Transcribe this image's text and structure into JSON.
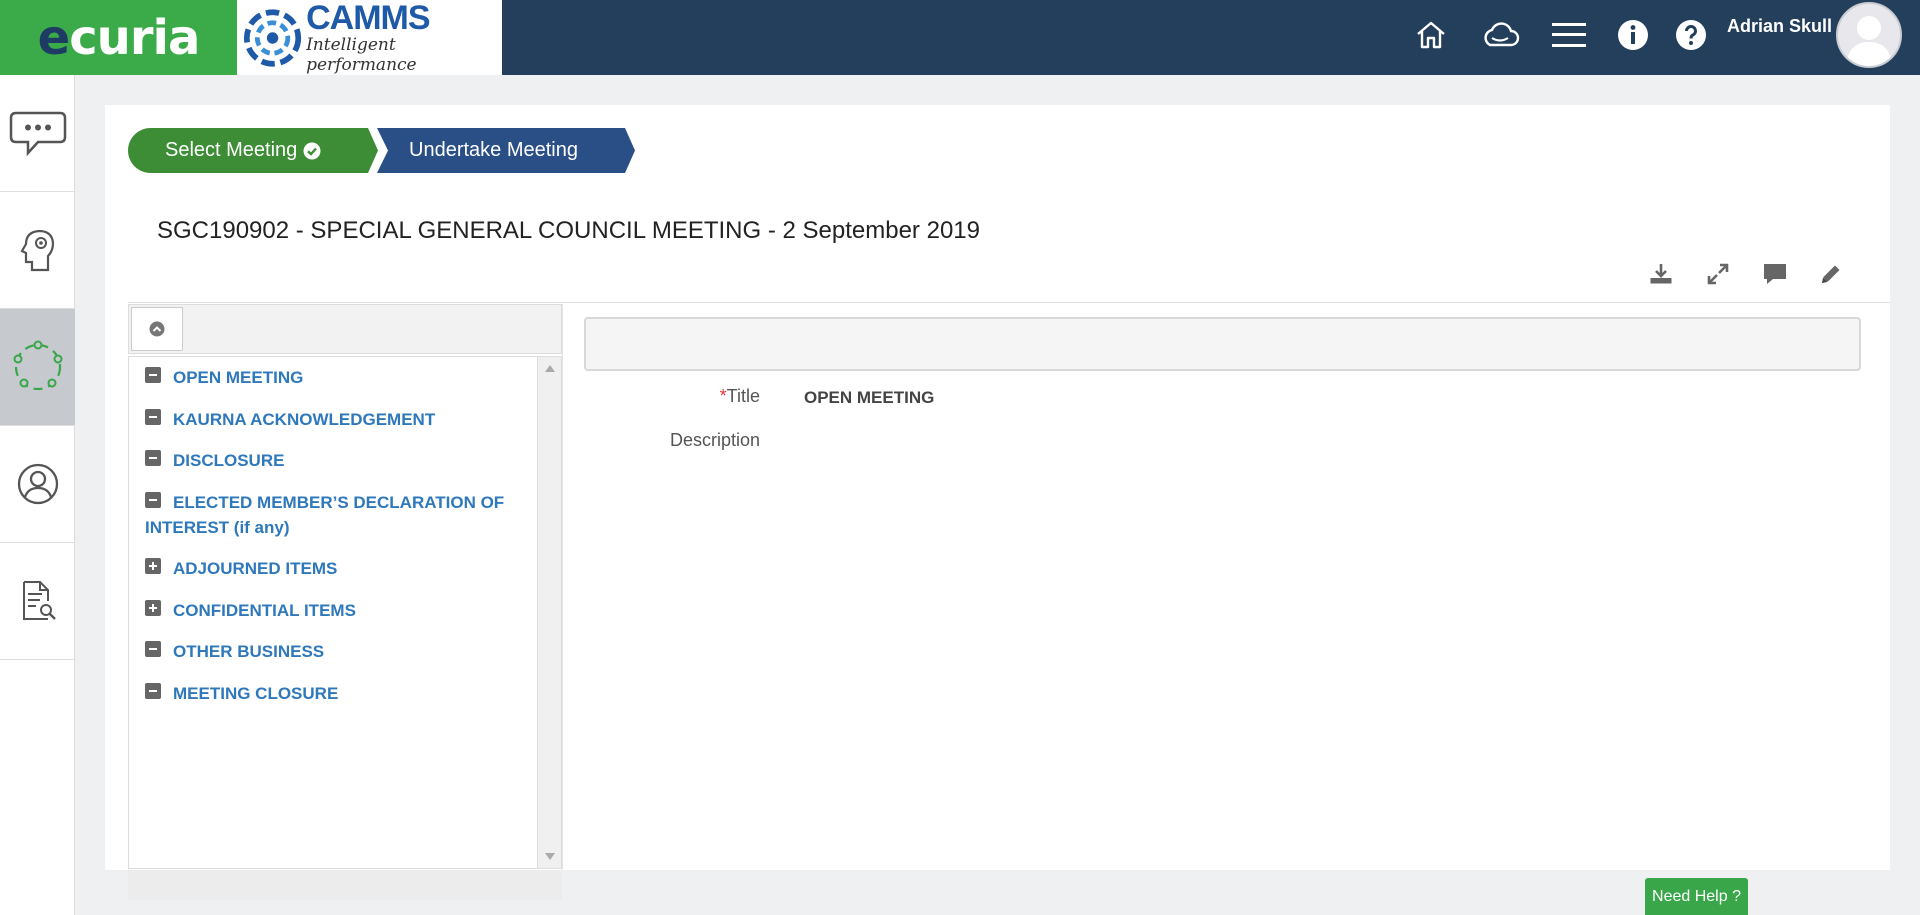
{
  "brand": {
    "ecuria_logo": "ecuria",
    "camms_name": "CAMMS",
    "camms_tagline": "Intelligent performance",
    "colors": {
      "header": "#233f5b",
      "ecuria_green": "#3bab4a",
      "link_blue": "#2e78bb"
    }
  },
  "header": {
    "icons": [
      "home-icon",
      "cloud-icon",
      "menu-icon",
      "info-icon",
      "help-icon"
    ],
    "user_name": "Adrian Skull"
  },
  "sidebar": {
    "items": [
      {
        "icon": "chat-bubble-icon",
        "active": false
      },
      {
        "icon": "head-gear-icon",
        "active": false
      },
      {
        "icon": "cycle-icon",
        "active": true
      },
      {
        "icon": "user-circle-icon",
        "active": false
      },
      {
        "icon": "document-search-icon",
        "active": false
      }
    ]
  },
  "wizard": {
    "step1": "Select Meeting",
    "step2": "Undertake Meeting"
  },
  "page": {
    "title": "SGC190902 - SPECIAL GENERAL COUNCIL MEETING - 2 September 2019"
  },
  "toolbar": {
    "icons": [
      "download-icon",
      "expand-icon",
      "comment-icon",
      "edit-icon"
    ]
  },
  "agenda": {
    "items": [
      {
        "label": "OPEN MEETING",
        "toggle": "minus"
      },
      {
        "label": "KAURNA ACKNOWLEDGEMENT",
        "toggle": "minus"
      },
      {
        "label": "DISCLOSURE",
        "toggle": "minus"
      },
      {
        "label": "ELECTED MEMBER’S DECLARATION OF INTEREST (if any)",
        "toggle": "minus"
      },
      {
        "label": "ADJOURNED ITEMS",
        "toggle": "plus"
      },
      {
        "label": "CONFIDENTIAL ITEMS",
        "toggle": "plus"
      },
      {
        "label": "OTHER BUSINESS",
        "toggle": "minus"
      },
      {
        "label": "MEETING CLOSURE",
        "toggle": "minus"
      }
    ]
  },
  "details": {
    "title_required": "*",
    "title_label": "Title",
    "title_value": "OPEN MEETING",
    "description_label": "Description"
  },
  "help": {
    "label": "Need Help ?"
  }
}
